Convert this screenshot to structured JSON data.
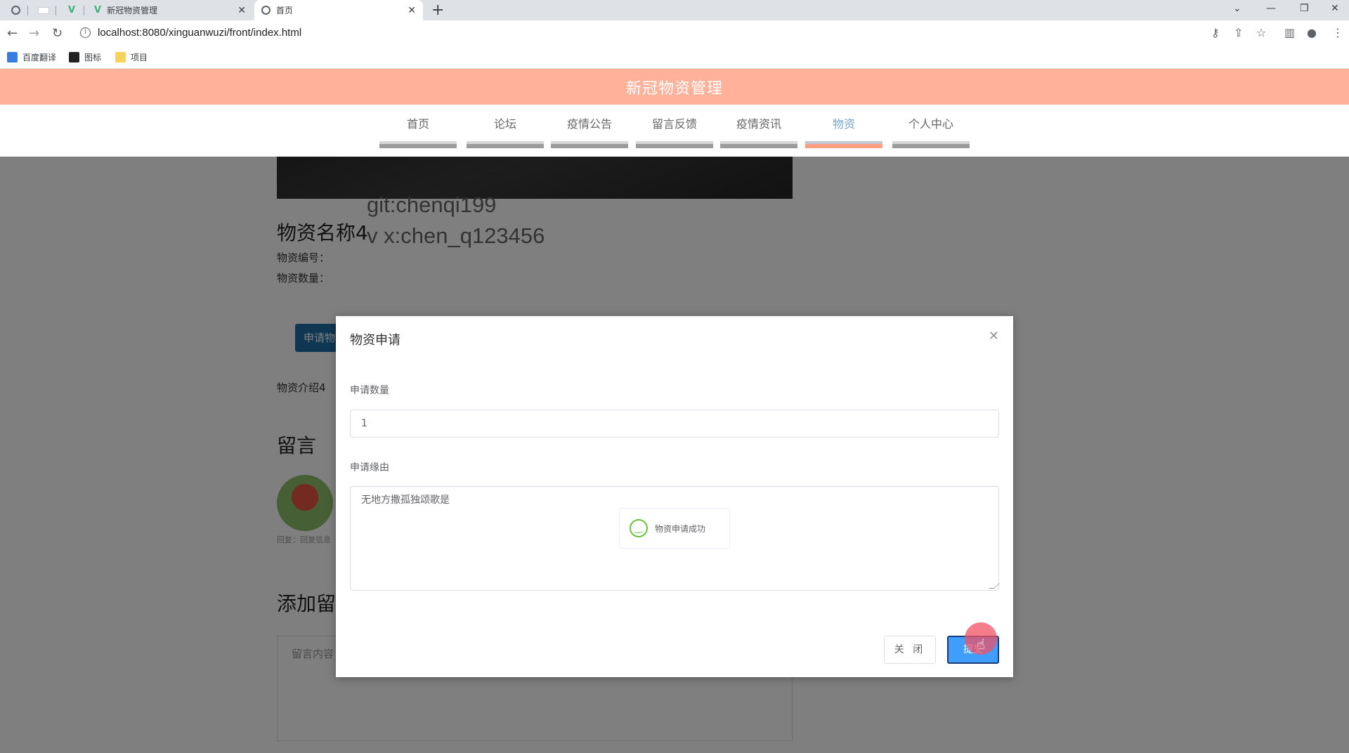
{
  "browser": {
    "tabs": [
      {
        "title": "新冠物资管理",
        "active": false
      },
      {
        "title": "首页",
        "active": true
      }
    ],
    "url": "localhost:8080/xinguanwuzi/front/index.html",
    "bookmarks": [
      "百度翻译",
      "图标",
      "项目"
    ]
  },
  "site": {
    "title": "新冠物资管理",
    "nav": [
      "首页",
      "论坛",
      "疫情公告",
      "留言反馈",
      "疫情资讯",
      "物资",
      "个人中心"
    ],
    "active_nav": "物资"
  },
  "goods": {
    "name": "物资名称4",
    "code_label": "物资编号：",
    "qty_label": "物资数量：",
    "apply_button": "申请物",
    "intro": "物资介绍4"
  },
  "comments": {
    "section_title": "留言",
    "reply_text": "回复：回复信息",
    "add_title": "添加留言",
    "placeholder": "留言内容"
  },
  "watermark": {
    "line1": "git:chenqi199",
    "line2": "v x:chen_q123456"
  },
  "dialog": {
    "title": "物资申请",
    "qty_label": "申请数量",
    "qty_value": "1",
    "reason_label": "申请缘由",
    "reason_value": "无地方撒孤独颂歌是",
    "toast": "物资申请成功",
    "close_button": "关 闭",
    "submit_button": "提交"
  },
  "colors": {
    "header": "#ffb199",
    "active_nav_bar": "#ff9f80",
    "primary": "#409eff"
  }
}
